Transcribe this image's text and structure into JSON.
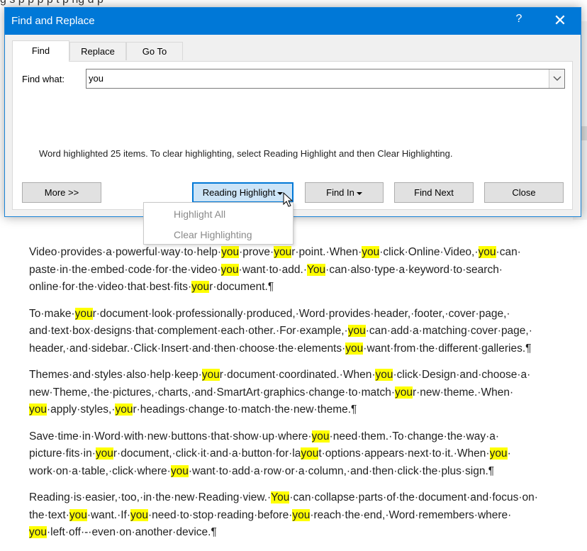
{
  "dialog": {
    "title": "Find and Replace",
    "help": "?",
    "close_glyph": "✕",
    "tabs": [
      {
        "label": "Find",
        "active": true
      },
      {
        "label": "Replace",
        "active": false
      },
      {
        "label": "Go To",
        "active": false
      }
    ],
    "find_label": "Find what:",
    "find_value": "you",
    "status": "Word highlighted 25 items. To clear highlighting, select Reading Highlight and then Clear Highlighting.",
    "buttons": {
      "more": "More >>",
      "reading_highlight": "Reading Highlight",
      "find_in": "Find In",
      "find_next": "Find Next",
      "close": "Close"
    },
    "menu": [
      "Highlight All",
      "Clear Highlighting"
    ]
  },
  "background": {
    "top_fragment": "g  s  p  p  p  p  t  p  ng  d  p"
  },
  "colors": {
    "accent": "#0078d7",
    "highlight": "#ffff00"
  },
  "document": {
    "paragraphs": [
      [
        "Video·provides·a·powerful·way·to·help·",
        {
          "h": "you"
        },
        "·prove·",
        {
          "h": "you"
        },
        "r·point.·When·",
        {
          "h": "you"
        },
        "·click·Online·Video,·",
        {
          "h": "you"
        },
        "·can·\npaste·in·the·embed·code·for·the·video·",
        {
          "h": "you"
        },
        "·want·to·add.·",
        {
          "h": "You"
        },
        "·can·also·type·a·keyword·to·search·\nonline·for·the·video·that·best·fits·",
        {
          "h": "you"
        },
        "r·document.¶"
      ],
      [
        "To·make·",
        {
          "h": "you"
        },
        "r·document·look·professionally·produced,·Word·provides·header,·footer,·cover·page,·\nand·text·box·designs·that·complement·each·other.·For·example,·",
        {
          "h": "you"
        },
        "·can·add·a·matching·cover·page,·\nheader,·and·sidebar.·Click·Insert·and·then·choose·the·elements·",
        {
          "h": "you"
        },
        "·want·from·the·different·galleries.¶"
      ],
      [
        "Themes·and·styles·also·help·keep·",
        {
          "h": "you"
        },
        "r·document·coordinated.·When·",
        {
          "h": "you"
        },
        "·click·Design·and·choose·a·\nnew·Theme,·the·pictures,·charts,·and·SmartArt·graphics·change·to·match·",
        {
          "h": "you"
        },
        "r·new·theme.·When·\n",
        {
          "h": "you"
        },
        "·apply·styles,·",
        {
          "h": "you"
        },
        "r·headings·change·to·match·the·new·theme.¶"
      ],
      [
        "Save·time·in·Word·with·new·buttons·that·show·up·where·",
        {
          "h": "you"
        },
        "·need·them.·To·change·the·way·a·\npicture·fits·in·",
        {
          "h": "you"
        },
        "r·document,·click·it·and·a·button·for·la",
        {
          "h": "you"
        },
        "t·options·appears·next·to·it.·When·",
        {
          "h": "you"
        },
        "·\nwork·on·a·table,·click·where·",
        {
          "h": "you"
        },
        "·want·to·add·a·row·or·a·column,·and·then·click·the·plus·sign.¶"
      ],
      [
        "Reading·is·easier,·too,·in·the·new·Reading·view.·",
        {
          "h": "You"
        },
        "·can·collapse·parts·of·the·document·and·focus·on·\nthe·text·",
        {
          "h": "you"
        },
        "·want.·If·",
        {
          "h": "you"
        },
        "·need·to·stop·reading·before·",
        {
          "h": "you"
        },
        "·reach·the·end,·Word·remembers·where·\n",
        {
          "h": "you"
        },
        "·left·off·-·even·on·another·device.¶"
      ]
    ]
  }
}
